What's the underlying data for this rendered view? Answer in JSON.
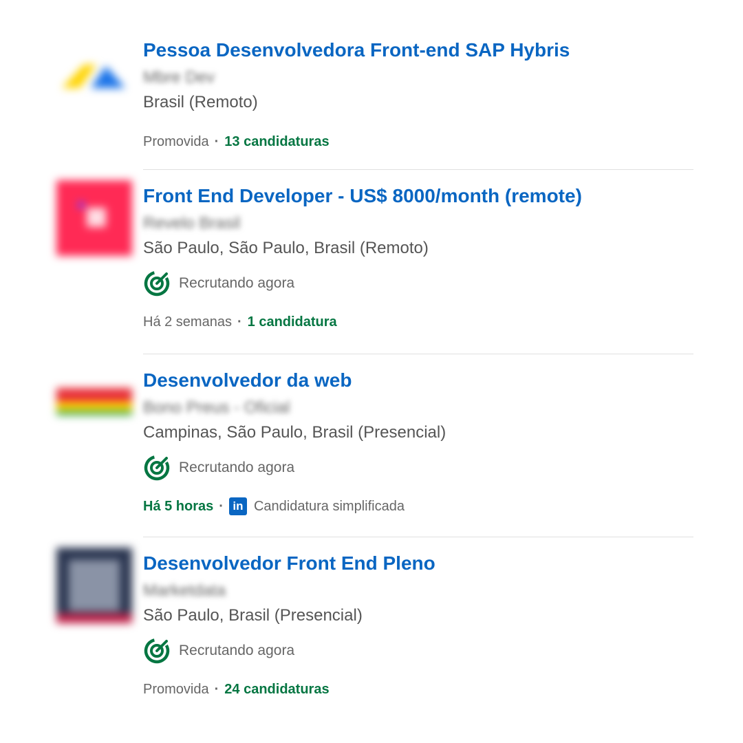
{
  "jobs": [
    {
      "title": "Pessoa Desenvolvedora Front-end SAP Hybris",
      "company": "Mbre Dev",
      "location": "Brasil (Remoto)",
      "footer": {
        "time": "Promovida",
        "applicants": "13 candidaturas"
      },
      "logo_colors": [
        "#ffd400",
        "#1a73e8"
      ]
    },
    {
      "title": "Front End Developer - US$ 8000/month (remote)",
      "company": "Revelo Brasil",
      "location": "São Paulo, São Paulo, Brasil (Remoto)",
      "insight": "Recrutando agora",
      "footer": {
        "time": "Há 2 semanas",
        "applicants": "1 candidatura"
      },
      "logo_colors": [
        "#ff2a55",
        "#ffffff"
      ]
    },
    {
      "title": "Desenvolvedor da web",
      "company": "Bono Preus - Oficial",
      "location": "Campinas, São Paulo, Brasil (Presencial)",
      "insight": "Recrutando agora",
      "footer": {
        "time": "Há 5 horas",
        "easy_apply": "Candidatura simplificada",
        "badge": "in"
      },
      "logo_colors": [
        "#e8303a",
        "#ffd400",
        "#4caf50"
      ]
    },
    {
      "title": "Desenvolvedor Front End Pleno",
      "company": "Marketdata",
      "location": "São Paulo, Brasil (Presencial)",
      "insight": "Recrutando agora",
      "footer": {
        "time": "Promovida",
        "applicants": "24 candidaturas"
      },
      "logo_colors": [
        "#2a3550",
        "#8a93a6",
        "#c2234a"
      ]
    }
  ],
  "icons": {
    "target": "target-icon",
    "linkedin": "linkedin-icon"
  },
  "colors": {
    "link": "#0a66c2",
    "green": "#057642",
    "muted": "#666666"
  }
}
